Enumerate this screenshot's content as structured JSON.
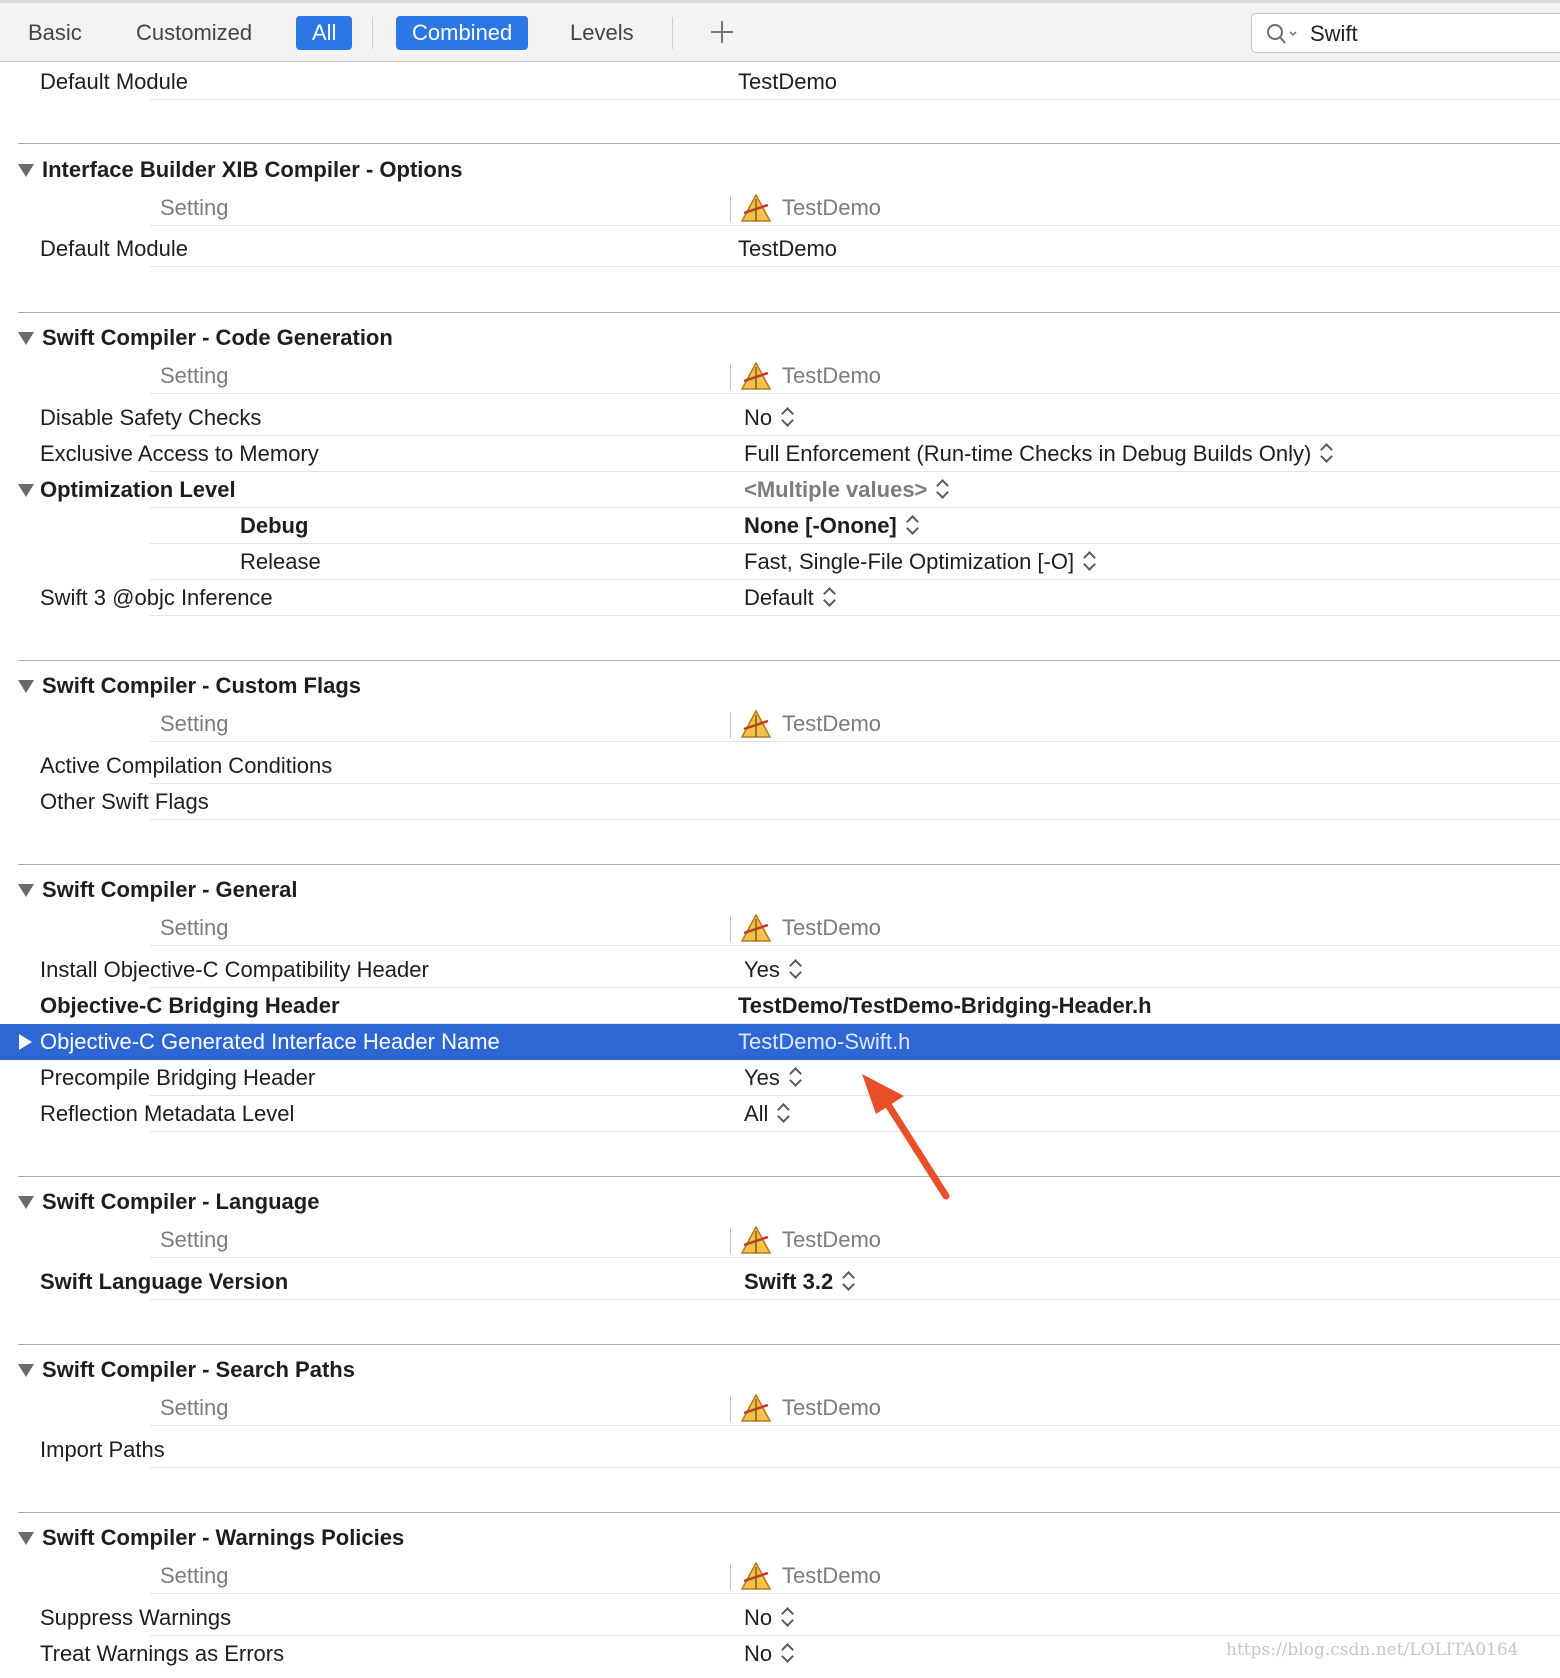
{
  "toolbar": {
    "tabs": [
      "Basic",
      "Customized",
      "All",
      "Combined",
      "Levels"
    ],
    "search_value": "Swift"
  },
  "top_row": {
    "label": "Default Module",
    "value": "TestDemo"
  },
  "header_row": {
    "setting": "Setting",
    "target": "TestDemo"
  },
  "sections": [
    {
      "title": "Interface Builder XIB Compiler - Options",
      "rows": [
        {
          "label": "Default Module",
          "value": "TestDemo"
        }
      ]
    },
    {
      "title": "Swift Compiler - Code Generation",
      "rows": [
        {
          "label": "Disable Safety Checks",
          "value": "No"
        },
        {
          "label": "Exclusive Access to Memory",
          "value": "Full Enforcement (Run-time Checks in Debug Builds Only)"
        },
        {
          "label": "Optimization Level",
          "value": "<Multiple values>"
        },
        {
          "label": "Debug",
          "value": "None [-Onone]"
        },
        {
          "label": "Release",
          "value": "Fast, Single-File Optimization [-O]"
        },
        {
          "label": "Swift 3 @objc Inference",
          "value": "Default"
        }
      ]
    },
    {
      "title": "Swift Compiler - Custom Flags",
      "rows": [
        {
          "label": "Active Compilation Conditions",
          "value": ""
        },
        {
          "label": "Other Swift Flags",
          "value": ""
        }
      ]
    },
    {
      "title": "Swift Compiler - General",
      "rows": [
        {
          "label": "Install Objective-C Compatibility Header",
          "value": "Yes"
        },
        {
          "label": "Objective-C Bridging Header",
          "value": "TestDemo/TestDemo-Bridging-Header.h"
        },
        {
          "label": "Objective-C Generated Interface Header Name",
          "value": "TestDemo-Swift.h"
        },
        {
          "label": "Precompile Bridging Header",
          "value": "Yes"
        },
        {
          "label": "Reflection Metadata Level",
          "value": "All"
        }
      ]
    },
    {
      "title": "Swift Compiler - Language",
      "rows": [
        {
          "label": "Swift Language Version",
          "value": "Swift 3.2"
        }
      ]
    },
    {
      "title": "Swift Compiler - Search Paths",
      "rows": [
        {
          "label": "Import Paths",
          "value": ""
        }
      ]
    },
    {
      "title": "Swift Compiler - Warnings Policies",
      "rows": [
        {
          "label": "Suppress Warnings",
          "value": "No"
        },
        {
          "label": "Treat Warnings as Errors",
          "value": "No"
        }
      ]
    }
  ],
  "watermark": "https://blog.csdn.net/LOLITA0164",
  "colors": {
    "accent": "#2b77e6",
    "selection": "#2e67d3",
    "arrow": "#e8502c"
  },
  "icons": {
    "target": "xcode-app-icon",
    "search": "search-icon",
    "add": "plus-icon",
    "stepper": "stepper-icon"
  }
}
